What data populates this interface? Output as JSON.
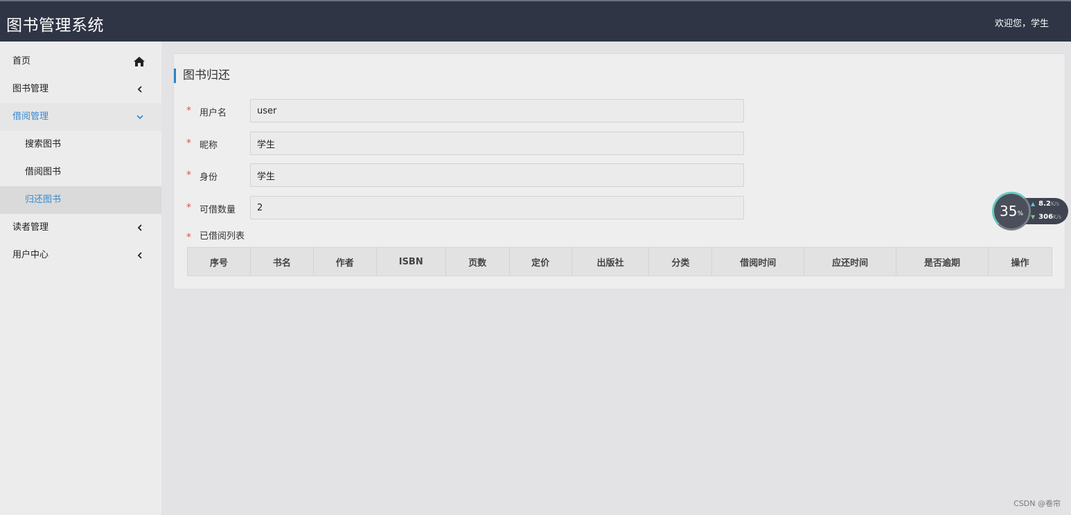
{
  "header": {
    "app_title": "图书管理系统",
    "welcome": "欢迎您，学生"
  },
  "sidebar": {
    "items": [
      {
        "label": "首页",
        "icon": "home-icon"
      },
      {
        "label": "图书管理",
        "icon": "chevron-left-icon"
      },
      {
        "label": "借阅管理",
        "icon": "chevron-down-icon"
      },
      {
        "label": "搜索图书"
      },
      {
        "label": "借阅图书"
      },
      {
        "label": "归还图书"
      },
      {
        "label": "读者管理",
        "icon": "chevron-left-icon"
      },
      {
        "label": "用户中心",
        "icon": "chevron-left-icon"
      }
    ],
    "accent_color": "#3a8ad0"
  },
  "main": {
    "title": "图书归还",
    "form": {
      "username": {
        "label": "用户名",
        "value": "user"
      },
      "nickname": {
        "label": "昵称",
        "value": "学生"
      },
      "identity": {
        "label": "身份",
        "value": "学生"
      },
      "borrow_quota": {
        "label": "可借数量",
        "value": "2"
      }
    },
    "required_mark": "*",
    "borrowed_list_label": "已借阅列表",
    "table": {
      "columns": [
        "序号",
        "书名",
        "作者",
        "ISBN",
        "页数",
        "定价",
        "出版社",
        "分类",
        "借阅时间",
        "应还时间",
        "是否逾期",
        "操作"
      ],
      "rows": []
    }
  },
  "net_monitor": {
    "percent": "35",
    "percent_unit": "%",
    "upload": "8.2",
    "upload_unit": "K/s",
    "download": "306",
    "download_unit": "K/s"
  },
  "watermark": "CSDN @卷帘",
  "colors": {
    "topbar": "#2f3545",
    "required": "#d9534f",
    "title_bar": "#2f7fc1"
  }
}
